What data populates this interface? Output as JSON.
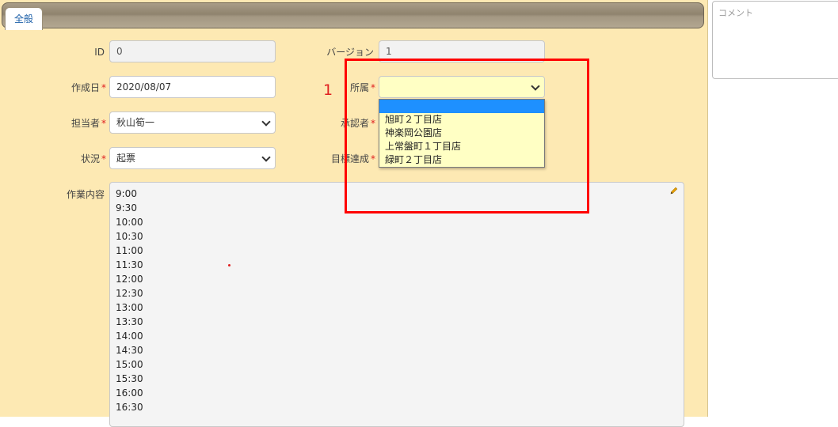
{
  "tabs": [
    {
      "label": "全般",
      "active": true
    }
  ],
  "fields": {
    "id": {
      "label": "ID",
      "value": "0"
    },
    "version": {
      "label": "バージョン",
      "value": "1"
    },
    "created": {
      "label": "作成日",
      "required_mark": "*",
      "value": "2020/08/07"
    },
    "affiliation": {
      "label": "所属",
      "required_mark": "*",
      "value": ""
    },
    "assignee": {
      "label": "担当者",
      "required_mark": "*",
      "value": "秋山筍一"
    },
    "approver": {
      "label": "承認者",
      "required_mark": "*"
    },
    "status": {
      "label": "状況",
      "required_mark": "*",
      "value": "起票"
    },
    "goal": {
      "label": "目標達成",
      "required_mark": "*"
    },
    "work": {
      "label": "作業内容",
      "lines": [
        "9:00",
        "9:30",
        "10:00",
        "10:30",
        "11:00",
        "11:30",
        "12:00",
        "12:30",
        "13:00",
        "13:30",
        "14:00",
        "14:30",
        "15:00",
        "15:30",
        "16:00",
        "16:30"
      ]
    }
  },
  "dropdown": {
    "options": [
      "",
      "旭町２丁目店",
      "神楽岡公園店",
      "上常盤町１丁目店",
      "緑町２丁目店"
    ],
    "highlighted_index": 0
  },
  "annotation": {
    "marker": "1",
    "color": "#ff0000"
  },
  "comment": {
    "placeholder": "コメント"
  },
  "colors": {
    "panel": "#fde9b3",
    "field_yellow": "#ffffc4",
    "option_highlight": "#1e90ff",
    "tab_text": "#1c5fa8"
  }
}
